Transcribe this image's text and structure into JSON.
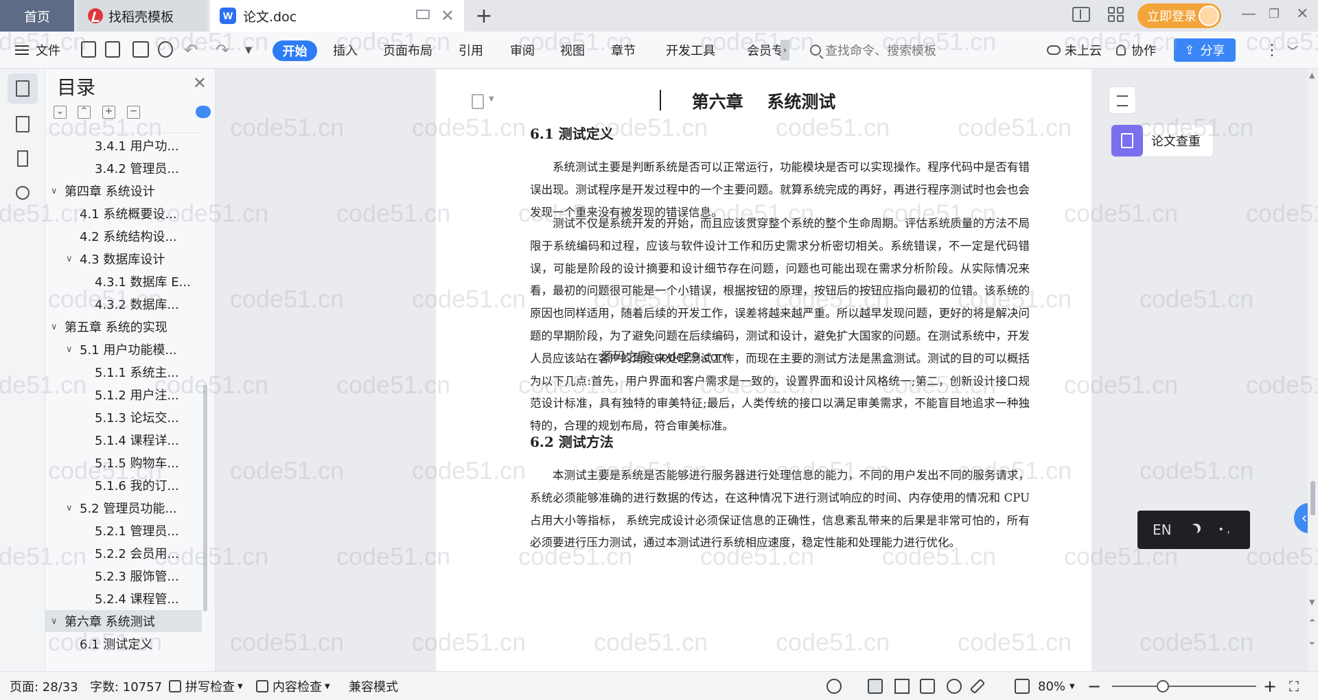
{
  "tabs": {
    "home": "首页",
    "docer": "找稻壳模板",
    "document": "论文.doc"
  },
  "titlebar": {
    "login": "立即登录"
  },
  "ribbon": {
    "file": "文件",
    "tabs": [
      "开始",
      "插入",
      "页面布局",
      "引用",
      "审阅",
      "视图",
      "章节",
      "开发工具",
      "会员专"
    ],
    "search_placeholder": "查找命令、搜索模板",
    "cloud": "未上云",
    "collab": "协作",
    "share": "分享"
  },
  "toc": {
    "title": "目录",
    "items": [
      {
        "level": 3,
        "label": "3.4.1 用户功...",
        "expand": ""
      },
      {
        "level": 3,
        "label": "3.4.2 管理员...",
        "expand": ""
      },
      {
        "level": 1,
        "label": "第四章  系统设计",
        "expand": "open"
      },
      {
        "level": 2,
        "label": "4.1 系统概要设...",
        "expand": ""
      },
      {
        "level": 2,
        "label": "4.2  系统结构设...",
        "expand": ""
      },
      {
        "level": 2,
        "label": "4.3  数据库设计",
        "expand": "open"
      },
      {
        "level": 3,
        "label": "4.3.1 数据库 E...",
        "expand": ""
      },
      {
        "level": 3,
        "label": "4.3.2 数据库...",
        "expand": ""
      },
      {
        "level": 1,
        "label": "第五章  系统的实现",
        "expand": "open"
      },
      {
        "level": 2,
        "label": "5.1  用户功能模...",
        "expand": "open"
      },
      {
        "level": 3,
        "label": "5.1.1 系统主...",
        "expand": ""
      },
      {
        "level": 3,
        "label": "5.1.2 用户注...",
        "expand": ""
      },
      {
        "level": 3,
        "label": "5.1.3 论坛交...",
        "expand": ""
      },
      {
        "level": 3,
        "label": "5.1.4 课程详...",
        "expand": ""
      },
      {
        "level": 3,
        "label": "5.1.5 购物车...",
        "expand": ""
      },
      {
        "level": 3,
        "label": "5.1.6 我的订...",
        "expand": ""
      },
      {
        "level": 2,
        "label": "5.2  管理员功能...",
        "expand": "open"
      },
      {
        "level": 3,
        "label": "5.2.1 管理员...",
        "expand": ""
      },
      {
        "level": 3,
        "label": "5.2.2 会员用...",
        "expand": ""
      },
      {
        "level": 3,
        "label": "5.2.3 服饰管...",
        "expand": ""
      },
      {
        "level": 3,
        "label": "5.2.4 课程管...",
        "expand": ""
      },
      {
        "level": 1,
        "label": "第六章    系统测试",
        "expand": "open",
        "selected": true
      },
      {
        "level": 2,
        "label": "6.1 测试定义",
        "expand": ""
      }
    ]
  },
  "document": {
    "chapter_title": "第六章    系统测试",
    "sec1_title": "6.1 测试定义",
    "sec1_para1": "系统测试主要是判断系统是否可以正常运行，功能模块是否可以实现操作。程序代码中是否有错误出现。测试程序是开发过程中的一个主要问题。就算系统完成的再好，再进行程序测试时也会也会发现一个重来没有被发现的错误信息。",
    "sec1_para2": "测试不仅是系统开发的开始，而且应该贯穿整个系统的整个生命周期。评估系统质量的方法不局限于系统编码和过程，应该与软件设计工作和历史需求分析密切相关。系统错误，不一定是代码错误，可能是阶段的设计摘要和设计细节存在问题，问题也可能出现在需求分析阶段。从实际情况来看，最初的问题很可能是一个小错误，根据按钮的原理，按钮后的按钮应指向最初的位错。该系统的原因也同样适用，随着后续的开发工作，误差将越来越严重。所以越早发现问题，更好的将是解决问题的早期阶段，为了避免问题在后续编码，测试和设计，避免扩大国家的问题。在测试系统中，开发人员应该站在客户的角度来处理测试工作，而现在主要的测试方法是黑盒测试。测试的目的可以概括为以下几点:首先，用户界面和客户需求是一致的，设置界面和设计风格统一;第二，创新设计接口规范设计标准，具有独特的审美特征;最后，人类传统的接口以满足审美需求，不能盲目地追求一种独特的，合理的规划布局，符合审美标准。",
    "sec2_title": "6.2 测试方法",
    "sec2_para1": "本测试主要是系统是否能够进行服务器进行处理信息的能力，不同的用户发出不同的服务请求，系统必须能够准确的进行数据的传达，在这种情况下进行测试响应的时间、内存使用的情况和 CPU 占用大小等指标， 系统完成设计必须保证信息的正确性，信息紊乱带来的后果是非常可怕的，所有必须要进行压力测试，通过本测试进行系统相应速度，稳定性能和处理能力进行优化。",
    "overlay": "源码之家 code29.com"
  },
  "widgets": {
    "plagiarism": "论文查重",
    "ime": "EN"
  },
  "watermark": "code51.cn",
  "statusbar": {
    "page": "页面: 28/33",
    "words": "字数: 10757",
    "spellcheck": "拼写检查",
    "content_check": "内容检查",
    "compat": "兼容模式",
    "zoom": "80%"
  },
  "colors": {
    "accent": "#2d7cf5",
    "login": "#f3a43a",
    "home_tab": "#5d6b86"
  }
}
